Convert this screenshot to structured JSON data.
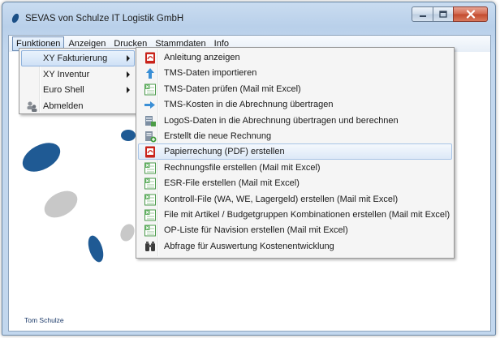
{
  "window": {
    "title": "SEVAS von Schulze IT Logistik GmbH"
  },
  "menubar": {
    "items": [
      {
        "label": "Funktionen"
      },
      {
        "label": "Anzeigen"
      },
      {
        "label": "Drucken"
      },
      {
        "label": "Stammdaten"
      },
      {
        "label": "Info"
      }
    ]
  },
  "main_menu": {
    "items": [
      {
        "label": "XY Fakturierung",
        "icon": "",
        "submenu": true
      },
      {
        "label": "XY Inventur",
        "icon": "",
        "submenu": true
      },
      {
        "label": "Euro Shell",
        "icon": "",
        "submenu": true
      },
      {
        "label": "Abmelden",
        "icon": "users-icon",
        "submenu": false
      }
    ]
  },
  "sub_menu": {
    "items": [
      {
        "label": "Anleitung anzeigen",
        "icon": "pdf-icon"
      },
      {
        "label": "TMS-Daten importieren",
        "icon": "arrow-up-icon"
      },
      {
        "label": "TMS-Daten prüfen (Mail mit Excel)",
        "icon": "excel-icon"
      },
      {
        "label": "TMS-Kosten in die Abrechnung übertragen",
        "icon": "arrow-right-icon"
      },
      {
        "label": "LogoS-Daten in die Abrechnung übertragen und berechnen",
        "icon": "database-icon"
      },
      {
        "label": "Erstellt die neue Rechnung",
        "icon": "document-add-icon"
      },
      {
        "label": "Papierrechung (PDF) erstellen",
        "icon": "pdf-icon"
      },
      {
        "label": "Rechnungsfile erstellen (Mail mit Excel)",
        "icon": "excel-icon"
      },
      {
        "label": "ESR-File erstellen (Mail mit Excel)",
        "icon": "excel-icon"
      },
      {
        "label": "Kontroll-File (WA, WE, Lagergeld) erstellen (Mail mit Excel)",
        "icon": "excel-icon"
      },
      {
        "label": "File mit Artikel / Budgetgruppen Kombinationen erstellen (Mail mit Excel)",
        "icon": "excel-icon"
      },
      {
        "label": "OP-Liste für Navision erstellen (Mail mit Excel)",
        "icon": "excel-icon"
      },
      {
        "label": "Abfrage für Auswertung Kostenentwicklung",
        "icon": "binoculars-icon"
      }
    ]
  },
  "footer": {
    "user_name": "Tom Schulze"
  },
  "colors": {
    "accent_blue": "#1f5a94",
    "decor_gray": "#c8c8c8"
  }
}
